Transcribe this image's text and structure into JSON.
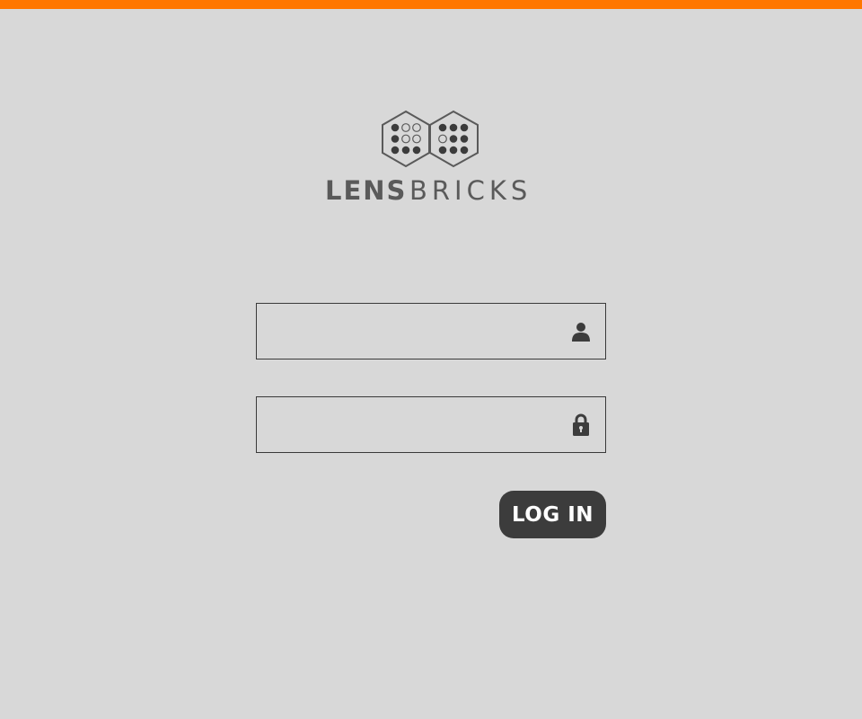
{
  "colors": {
    "accent": "#ff7700",
    "background": "#d8d8d8",
    "dark": "#3c3c3c",
    "logo_gray": "#5a5a5a"
  },
  "logo": {
    "word_bold": "LENS",
    "word_light": "BRICKS"
  },
  "form": {
    "username": {
      "value": "",
      "placeholder": "",
      "icon": "user-icon"
    },
    "password": {
      "value": "",
      "placeholder": "",
      "icon": "lock-icon"
    },
    "login_label": "LOG IN"
  }
}
